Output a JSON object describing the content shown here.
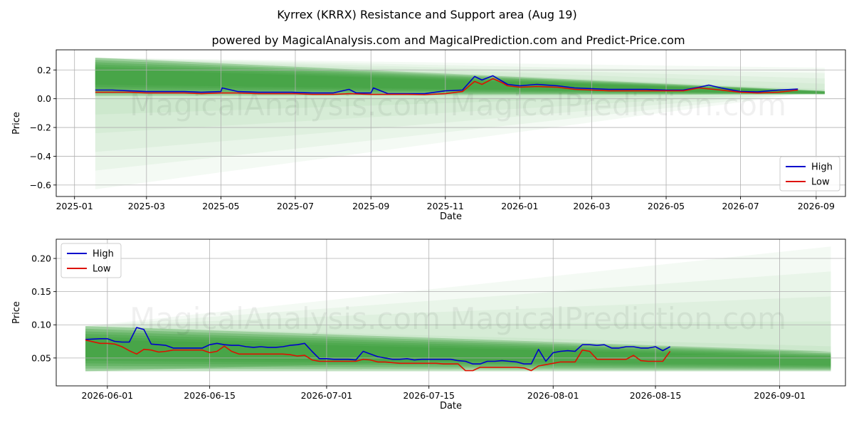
{
  "title": "Kyrrex (KRRX) Resistance and Support area (Aug 19)",
  "subtitle": "powered by MagicalAnalysis.com and MagicalPrediction.com and Predict-Price.com",
  "watermark": "MagicalAnalysis.com    MagicalPrediction.com",
  "colors": {
    "high": "#0000cc",
    "low": "#dd1100",
    "band_dark": "#3a9e3a",
    "band_light": "#cfe8cf",
    "grid": "#b0b0b0"
  },
  "chart_data": [
    {
      "type": "line",
      "xlabel": "Date",
      "ylabel": "Price",
      "x_tick_labels": [
        "2025-01",
        "2025-03",
        "2025-05",
        "2025-07",
        "2025-09",
        "2025-11",
        "2026-01",
        "2026-03",
        "2026-05",
        "2026-07",
        "2026-09"
      ],
      "x_tick_dates": [
        "2025-01-01",
        "2025-03-01",
        "2025-05-01",
        "2025-07-01",
        "2025-09-01",
        "2025-11-01",
        "2026-01-01",
        "2026-03-01",
        "2026-05-01",
        "2026-07-01",
        "2026-09-01"
      ],
      "xlim": [
        "2024-12-17",
        "2026-09-25"
      ],
      "y_ticks": [
        0.2,
        0.0,
        -0.2,
        -0.4,
        -0.6
      ],
      "y_tick_labels": [
        "0.2",
        "0.0",
        "−0.2",
        "−0.4",
        "−0.6"
      ],
      "ylim": [
        -0.68,
        0.34
      ],
      "grid": true,
      "legend": "bottom-right",
      "series": [
        {
          "name": "High",
          "x": [
            "2025-01-18",
            "2025-02-01",
            "2025-02-15",
            "2025-03-01",
            "2025-03-15",
            "2025-04-01",
            "2025-04-15",
            "2025-05-01",
            "2025-05-02",
            "2025-05-15",
            "2025-06-01",
            "2025-06-15",
            "2025-06-28",
            "2025-07-15",
            "2025-08-01",
            "2025-08-14",
            "2025-08-20",
            "2025-09-01",
            "2025-09-03",
            "2025-09-15",
            "2025-10-01",
            "2025-10-15",
            "2025-11-01",
            "2025-11-15",
            "2025-11-25",
            "2025-12-01",
            "2025-12-10",
            "2025-12-18",
            "2025-12-22",
            "2026-01-01",
            "2026-01-15",
            "2026-02-01",
            "2026-02-15",
            "2026-03-01",
            "2026-03-15",
            "2026-04-01",
            "2026-04-15",
            "2026-05-01",
            "2026-05-15",
            "2026-05-28",
            "2026-06-05",
            "2026-06-15",
            "2026-07-01",
            "2026-07-15",
            "2026-08-01",
            "2026-08-17"
          ],
          "values": [
            0.06,
            0.06,
            0.055,
            0.05,
            0.05,
            0.05,
            0.045,
            0.05,
            0.075,
            0.05,
            0.045,
            0.045,
            0.045,
            0.04,
            0.04,
            0.065,
            0.04,
            0.04,
            0.075,
            0.035,
            0.035,
            0.035,
            0.055,
            0.06,
            0.155,
            0.13,
            0.16,
            0.12,
            0.1,
            0.09,
            0.1,
            0.09,
            0.075,
            0.07,
            0.065,
            0.065,
            0.065,
            0.06,
            0.06,
            0.08,
            0.095,
            0.075,
            0.05,
            0.048,
            0.06,
            0.067
          ]
        },
        {
          "name": "Low",
          "x": [
            "2025-01-18",
            "2025-02-01",
            "2025-02-15",
            "2025-03-01",
            "2025-03-15",
            "2025-04-01",
            "2025-04-15",
            "2025-05-01",
            "2025-05-15",
            "2025-06-01",
            "2025-06-15",
            "2025-07-01",
            "2025-07-15",
            "2025-08-01",
            "2025-08-15",
            "2025-09-01",
            "2025-09-15",
            "2025-10-01",
            "2025-10-15",
            "2025-11-01",
            "2025-11-15",
            "2025-11-25",
            "2025-12-01",
            "2025-12-10",
            "2025-12-18",
            "2025-12-22",
            "2026-01-01",
            "2026-01-15",
            "2026-02-01",
            "2026-02-15",
            "2026-03-01",
            "2026-03-15",
            "2026-04-01",
            "2026-04-15",
            "2026-05-01",
            "2026-05-15",
            "2026-05-28",
            "2026-06-15",
            "2026-07-01",
            "2026-07-15",
            "2026-08-01",
            "2026-08-17"
          ],
          "values": [
            0.045,
            0.045,
            0.045,
            0.04,
            0.04,
            0.04,
            0.035,
            0.04,
            0.04,
            0.035,
            0.035,
            0.035,
            0.03,
            0.03,
            0.035,
            0.03,
            0.03,
            0.03,
            0.028,
            0.035,
            0.05,
            0.12,
            0.1,
            0.14,
            0.11,
            0.09,
            0.08,
            0.085,
            0.08,
            0.065,
            0.06,
            0.055,
            0.055,
            0.055,
            0.055,
            0.055,
            0.075,
            0.06,
            0.045,
            0.04,
            0.045,
            0.06
          ]
        }
      ]
    },
    {
      "type": "line",
      "xlabel": "Date",
      "ylabel": "Price",
      "x_tick_labels": [
        "2026-06-01",
        "2026-06-15",
        "2026-07-01",
        "2026-07-15",
        "2026-08-01",
        "2026-08-15",
        "2026-09-01"
      ],
      "x_tick_dates": [
        "2026-06-01",
        "2026-06-15",
        "2026-07-01",
        "2026-07-15",
        "2026-08-01",
        "2026-08-15",
        "2026-09-01"
      ],
      "xlim": [
        "2026-05-25",
        "2026-09-10"
      ],
      "y_ticks": [
        0.05,
        0.1,
        0.15,
        0.2
      ],
      "y_tick_labels": [
        "0.05",
        "0.10",
        "0.15",
        "0.20"
      ],
      "ylim": [
        0.008,
        0.229
      ],
      "grid": true,
      "legend": "top-left",
      "series": [
        {
          "name": "High",
          "x": [
            "2026-05-29",
            "2026-05-31",
            "2026-06-01",
            "2026-06-02",
            "2026-06-03",
            "2026-06-04",
            "2026-06-05",
            "2026-06-06",
            "2026-06-07",
            "2026-06-08",
            "2026-06-09",
            "2026-06-10",
            "2026-06-11",
            "2026-06-12",
            "2026-06-13",
            "2026-06-14",
            "2026-06-15",
            "2026-06-16",
            "2026-06-17",
            "2026-06-18",
            "2026-06-19",
            "2026-06-20",
            "2026-06-21",
            "2026-06-22",
            "2026-06-23",
            "2026-06-24",
            "2026-06-25",
            "2026-06-26",
            "2026-06-27",
            "2026-06-28",
            "2026-06-29",
            "2026-06-30",
            "2026-07-01",
            "2026-07-02",
            "2026-07-03",
            "2026-07-04",
            "2026-07-05",
            "2026-07-06",
            "2026-07-07",
            "2026-07-08",
            "2026-07-09",
            "2026-07-10",
            "2026-07-11",
            "2026-07-12",
            "2026-07-13",
            "2026-07-14",
            "2026-07-15",
            "2026-07-16",
            "2026-07-17",
            "2026-07-18",
            "2026-07-19",
            "2026-07-20",
            "2026-07-21",
            "2026-07-22",
            "2026-07-23",
            "2026-07-24",
            "2026-07-25",
            "2026-07-26",
            "2026-07-27",
            "2026-07-28",
            "2026-07-29",
            "2026-07-30",
            "2026-07-31",
            "2026-08-01",
            "2026-08-02",
            "2026-08-03",
            "2026-08-04",
            "2026-08-05",
            "2026-08-06",
            "2026-08-07",
            "2026-08-08",
            "2026-08-09",
            "2026-08-10",
            "2026-08-11",
            "2026-08-12",
            "2026-08-13",
            "2026-08-14",
            "2026-08-15",
            "2026-08-16",
            "2026-08-17"
          ],
          "values": [
            0.078,
            0.079,
            0.079,
            0.075,
            0.074,
            0.074,
            0.096,
            0.093,
            0.071,
            0.07,
            0.069,
            0.065,
            0.065,
            0.065,
            0.065,
            0.065,
            0.07,
            0.072,
            0.07,
            0.069,
            0.069,
            0.067,
            0.066,
            0.067,
            0.066,
            0.066,
            0.067,
            0.069,
            0.07,
            0.072,
            0.06,
            0.049,
            0.049,
            0.048,
            0.048,
            0.048,
            0.047,
            0.06,
            0.056,
            0.052,
            0.05,
            0.048,
            0.048,
            0.049,
            0.047,
            0.048,
            0.048,
            0.048,
            0.048,
            0.048,
            0.046,
            0.045,
            0.041,
            0.041,
            0.045,
            0.045,
            0.046,
            0.045,
            0.044,
            0.041,
            0.041,
            0.063,
            0.045,
            0.058,
            0.06,
            0.061,
            0.06,
            0.07,
            0.07,
            0.069,
            0.07,
            0.065,
            0.065,
            0.067,
            0.067,
            0.065,
            0.065,
            0.067,
            0.061,
            0.067
          ]
        },
        {
          "name": "Low",
          "x": [
            "2026-05-29",
            "2026-05-31",
            "2026-06-01",
            "2026-06-02",
            "2026-06-03",
            "2026-06-04",
            "2026-06-05",
            "2026-06-06",
            "2026-06-07",
            "2026-06-08",
            "2026-06-09",
            "2026-06-10",
            "2026-06-11",
            "2026-06-12",
            "2026-06-13",
            "2026-06-14",
            "2026-06-15",
            "2026-06-16",
            "2026-06-17",
            "2026-06-18",
            "2026-06-19",
            "2026-06-20",
            "2026-06-21",
            "2026-06-22",
            "2026-06-23",
            "2026-06-24",
            "2026-06-25",
            "2026-06-26",
            "2026-06-27",
            "2026-06-28",
            "2026-06-29",
            "2026-06-30",
            "2026-07-01",
            "2026-07-02",
            "2026-07-03",
            "2026-07-04",
            "2026-07-05",
            "2026-07-06",
            "2026-07-07",
            "2026-07-08",
            "2026-07-09",
            "2026-07-10",
            "2026-07-11",
            "2026-07-12",
            "2026-07-13",
            "2026-07-14",
            "2026-07-15",
            "2026-07-16",
            "2026-07-17",
            "2026-07-18",
            "2026-07-19",
            "2026-07-20",
            "2026-07-21",
            "2026-07-22",
            "2026-07-23",
            "2026-07-24",
            "2026-07-25",
            "2026-07-26",
            "2026-07-27",
            "2026-07-28",
            "2026-07-29",
            "2026-07-30",
            "2026-07-31",
            "2026-08-01",
            "2026-08-02",
            "2026-08-03",
            "2026-08-04",
            "2026-08-05",
            "2026-08-06",
            "2026-08-07",
            "2026-08-08",
            "2026-08-09",
            "2026-08-10",
            "2026-08-11",
            "2026-08-12",
            "2026-08-13",
            "2026-08-14",
            "2026-08-15",
            "2026-08-16",
            "2026-08-17"
          ],
          "values": [
            0.077,
            0.072,
            0.072,
            0.071,
            0.067,
            0.061,
            0.056,
            0.063,
            0.062,
            0.059,
            0.06,
            0.062,
            0.062,
            0.062,
            0.062,
            0.062,
            0.058,
            0.06,
            0.068,
            0.06,
            0.056,
            0.056,
            0.056,
            0.056,
            0.056,
            0.056,
            0.056,
            0.055,
            0.053,
            0.054,
            0.047,
            0.045,
            0.045,
            0.045,
            0.045,
            0.045,
            0.045,
            0.048,
            0.047,
            0.044,
            0.044,
            0.043,
            0.042,
            0.042,
            0.042,
            0.042,
            0.042,
            0.042,
            0.041,
            0.041,
            0.041,
            0.031,
            0.031,
            0.036,
            0.036,
            0.036,
            0.036,
            0.036,
            0.036,
            0.035,
            0.031,
            0.038,
            0.04,
            0.042,
            0.044,
            0.044,
            0.044,
            0.062,
            0.06,
            0.048,
            0.048,
            0.048,
            0.048,
            0.048,
            0.054,
            0.046,
            0.045,
            0.045,
            0.045,
            0.06
          ]
        }
      ]
    }
  ]
}
